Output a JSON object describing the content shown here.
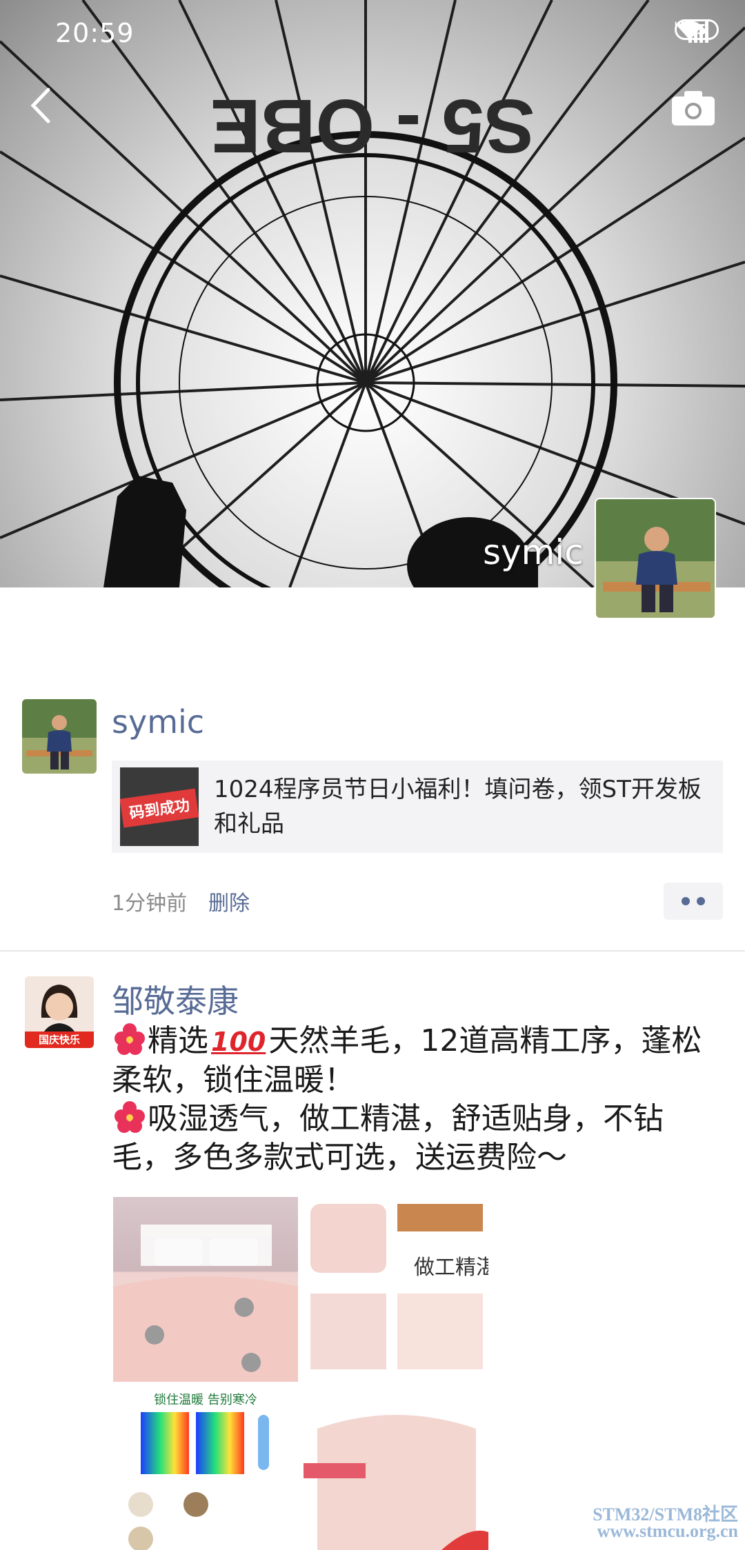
{
  "status_bar": {
    "time": "20:59",
    "network": "HD",
    "battery": "65"
  },
  "cover": {
    "owner_name": "symic",
    "balloon_letters": "S5 - OBE"
  },
  "post1": {
    "nickname": "symic",
    "link_thumb_text": "码到成功",
    "link_title": "1024程序员节日小福利！填问卷，领ST开发板和礼品",
    "time": "1分钟前",
    "delete_label": "删除"
  },
  "post2": {
    "nickname": "邹敬泰康",
    "avatar_badge": "国庆快乐",
    "line1_a": "精选",
    "line1_b": "天然羊毛，12道高精工序，蓬松柔软，锁住温暖！",
    "line2": "吸湿透气，做工精湛，舒适贴身，不钻毛，多色多款式可选，送运费险～",
    "emoji_100": "100",
    "img2_text": "做工精湛",
    "img3_caption": "锁住温暖 告别寒冷"
  },
  "watermark": {
    "line1": "STM32/STM8社区",
    "line2": "www.stmcu.org.cn"
  },
  "colors": {
    "link_blue": "#576b95",
    "card_bg": "#f3f3f5",
    "meta_gray": "#8a8a8a",
    "divider": "#e5e5e5"
  }
}
